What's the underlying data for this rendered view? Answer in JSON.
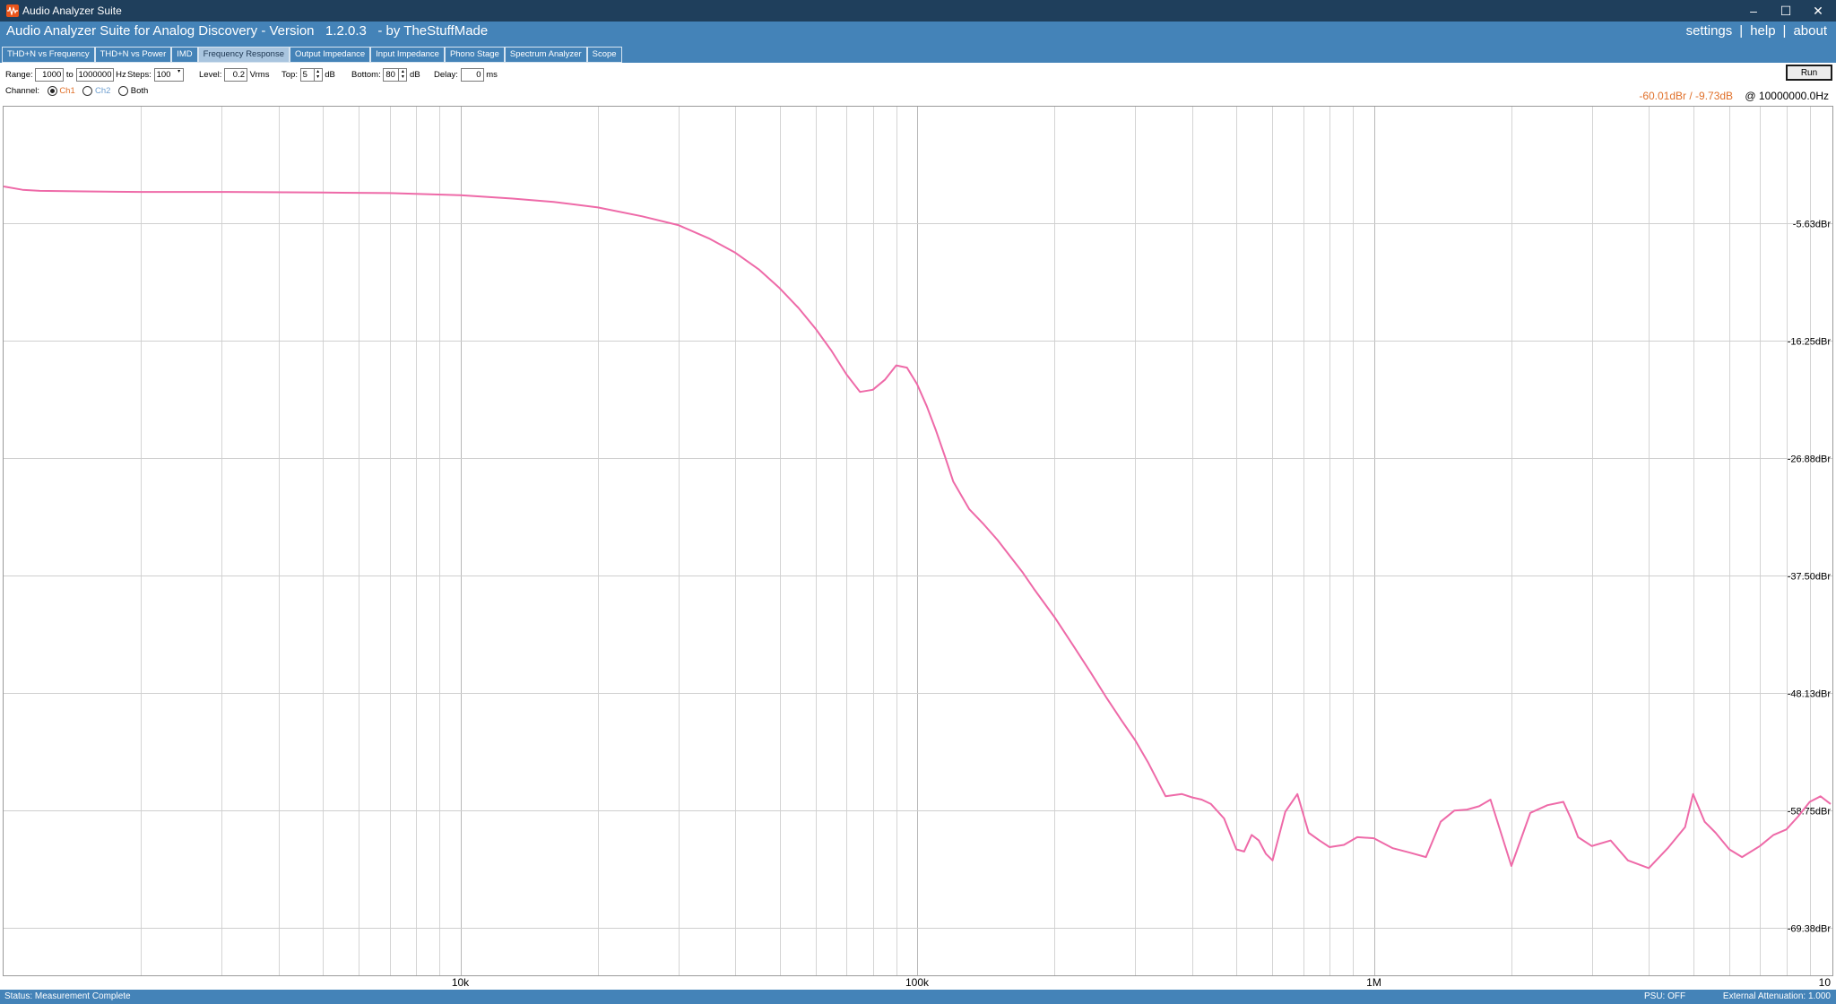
{
  "window": {
    "title": "Audio Analyzer Suite",
    "controls": [
      "–",
      "☐",
      "✕"
    ]
  },
  "header": {
    "app_title": "Audio Analyzer Suite for Analog Discovery - Version   1.2.0.3   - by TheStuffMade",
    "links": [
      "settings",
      "help",
      "about"
    ],
    "separator": "|"
  },
  "tabs": [
    {
      "label": "THD+N vs Frequency",
      "active": false
    },
    {
      "label": "THD+N vs Power",
      "active": false
    },
    {
      "label": "IMD",
      "active": false
    },
    {
      "label": "Frequency Response",
      "active": true
    },
    {
      "label": "Output Impedance",
      "active": false
    },
    {
      "label": "Input Impedance",
      "active": false
    },
    {
      "label": "Phono Stage",
      "active": false
    },
    {
      "label": "Spectrum Analyzer",
      "active": false
    },
    {
      "label": "Scope",
      "active": false
    }
  ],
  "controls": {
    "range_label": "Range:",
    "range_from": "1000",
    "to_label": "to",
    "range_to": "1000000",
    "hz_label": "Hz",
    "steps_label": "Steps:",
    "steps_value": "100",
    "level_label": "Level:",
    "level_value": "0.2",
    "vrms_label": "Vrms",
    "top_label": "Top:",
    "top_value": "5",
    "db_label_1": "dB",
    "bottom_label": "Bottom:",
    "bottom_value": "80",
    "db_label_2": "dB",
    "delay_label": "Delay:",
    "delay_value": "0",
    "ms_label": "ms",
    "run_label": "Run",
    "channel_label": "Channel:",
    "ch1_label": "Ch1",
    "ch2_label": "Ch2",
    "both_label": "Both",
    "selected_channel": "Ch1"
  },
  "readout": {
    "values": "-60.01dBr / -9.73dB",
    "freq": "@ 10000000.0Hz",
    "value_color": "#e0702a"
  },
  "chart_data": {
    "type": "line",
    "xscale": "log",
    "xlim": [
      1000,
      10000000
    ],
    "ylim": [
      -75,
      5
    ],
    "xtick_labels": [
      {
        "x": 10000,
        "label": "10k"
      },
      {
        "x": 100000,
        "label": "100k"
      },
      {
        "x": 1000000,
        "label": "1M"
      },
      {
        "x": 10000000,
        "label": "10"
      }
    ],
    "ytick_labels": [
      {
        "y": -5.63,
        "label": "-5.63dBr"
      },
      {
        "y": -16.25,
        "label": "-16.25dBr"
      },
      {
        "y": -26.88,
        "label": "-26.88dBr"
      },
      {
        "y": -37.5,
        "label": "-37.50dBr"
      },
      {
        "y": -48.13,
        "label": "-48.13dBr"
      },
      {
        "y": -58.75,
        "label": "-58.75dBr"
      },
      {
        "y": -69.38,
        "label": "-69.38dBr"
      }
    ],
    "grid": true,
    "series": [
      {
        "color": "#ee6aa8",
        "x": [
          1000,
          1100,
          1200,
          1500,
          2000,
          3000,
          5000,
          7000,
          10000,
          13000,
          16000,
          20000,
          25000,
          30000,
          35000,
          40000,
          45000,
          50000,
          55000,
          60000,
          65000,
          70000,
          75000,
          80000,
          85000,
          90000,
          95000,
          100000,
          105000,
          110000,
          115000,
          120000,
          130000,
          140000,
          150000,
          160000,
          170000,
          180000,
          200000,
          220000,
          240000,
          260000,
          280000,
          300000,
          320000,
          350000,
          380000,
          400000,
          420000,
          440000,
          470000,
          500000,
          520000,
          540000,
          560000,
          580000,
          600000,
          640000,
          680000,
          720000,
          760000,
          800000,
          860000,
          920000,
          1000000,
          1100000,
          1200000,
          1300000,
          1400000,
          1500000,
          1600000,
          1700000,
          1800000,
          2000000,
          2200000,
          2400000,
          2600000,
          2700000,
          2800000,
          3000000,
          3300000,
          3600000,
          4000000,
          4400000,
          4800000,
          5000000,
          5300000,
          5600000,
          6000000,
          6400000,
          7000000,
          7500000,
          8000000,
          8500000,
          9000000,
          9500000,
          10000000
        ],
        "y": [
          -2.3,
          -2.6,
          -2.7,
          -2.75,
          -2.8,
          -2.8,
          -2.85,
          -2.9,
          -3.1,
          -3.4,
          -3.7,
          -4.2,
          -5.0,
          -5.8,
          -7.0,
          -8.3,
          -9.8,
          -11.5,
          -13.3,
          -15.2,
          -17.2,
          -19.3,
          -20.9,
          -20.7,
          -19.8,
          -18.5,
          -18.7,
          -20.2,
          -22.2,
          -24.4,
          -26.7,
          -29.0,
          -31.5,
          -32.9,
          -34.3,
          -35.8,
          -37.2,
          -38.7,
          -41.3,
          -43.9,
          -46.3,
          -48.6,
          -50.6,
          -52.4,
          -54.4,
          -57.5,
          -57.3,
          -57.6,
          -57.8,
          -58.2,
          -59.5,
          -62.3,
          -62.5,
          -61.0,
          -61.5,
          -62.7,
          -63.3,
          -58.9,
          -57.3,
          -60.8,
          -61.5,
          -62.1,
          -61.9,
          -61.2,
          -61.3,
          -62.2,
          -62.6,
          -63.0,
          -59.8,
          -58.8,
          -58.7,
          -58.4,
          -57.8,
          -63.8,
          -59.0,
          -58.3,
          -58.0,
          -59.5,
          -61.2,
          -62.0,
          -61.5,
          -63.3,
          -64.0,
          -62.2,
          -60.3,
          -57.3,
          -59.8,
          -60.8,
          -62.3,
          -63.0,
          -62.0,
          -61.0,
          -60.5,
          -59.3,
          -58.0,
          -57.5,
          -58.2
        ]
      }
    ]
  },
  "status": {
    "left": "Status: Measurement Complete",
    "psu": "PSU: OFF",
    "attenuation": "External Attenuation: 1.000"
  }
}
